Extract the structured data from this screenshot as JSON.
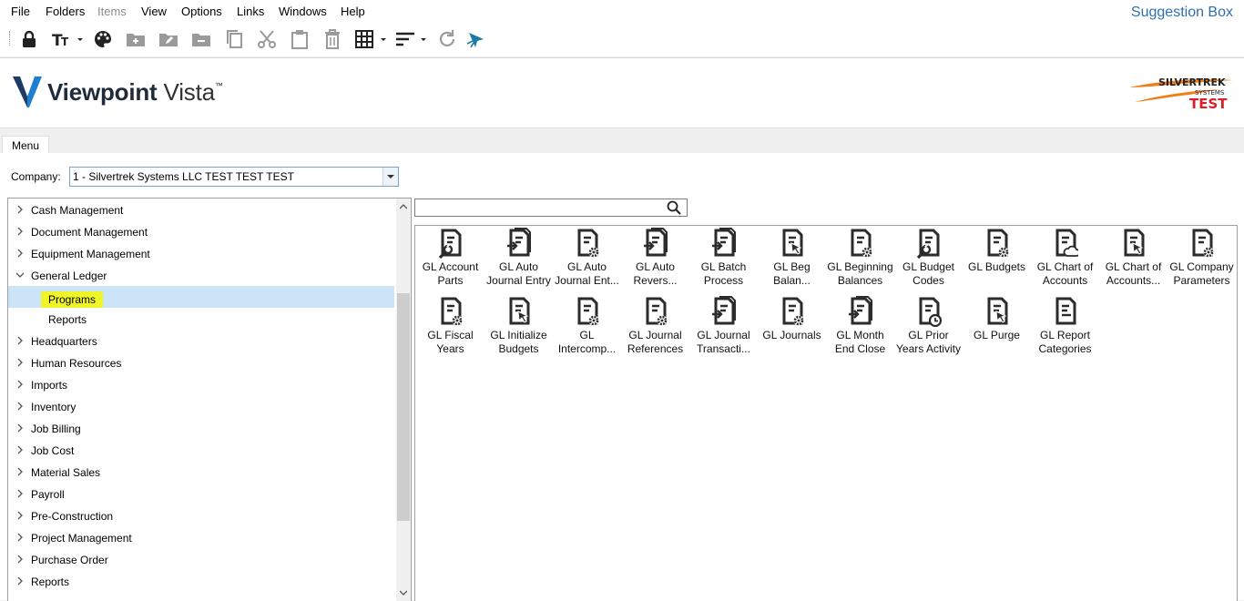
{
  "menu": [
    "File",
    "Folders",
    "Items",
    "View",
    "Options",
    "Links",
    "Windows",
    "Help"
  ],
  "menu_disabled": [
    "Items"
  ],
  "suggestion_box": "Suggestion Box",
  "toolbar_icons": [
    "lock-icon",
    "font-icon",
    "palette-icon",
    "add-folder-icon",
    "edit-folder-icon",
    "remove-folder-icon",
    "copy-icon",
    "cut-icon",
    "paste-icon",
    "delete-icon",
    "grid-icon",
    "sort-icon",
    "refresh-icon",
    "pointer-icon"
  ],
  "brand": {
    "name_bold": "Viewpoint",
    "name_light": "Vista",
    "tm": "™"
  },
  "company_logo": {
    "line1": "SILVERTREK",
    "line2": "SYSTEMS",
    "line3": "TEST"
  },
  "tab": "Menu",
  "company": {
    "label": "Company:",
    "value": "1 - Silvertrek Systems LLC TEST TEST TEST"
  },
  "tree": [
    {
      "label": "Cash Management",
      "level": 0,
      "expanded": false
    },
    {
      "label": "Document Management",
      "level": 0,
      "expanded": false
    },
    {
      "label": "Equipment Management",
      "level": 0,
      "expanded": false
    },
    {
      "label": "General Ledger",
      "level": 0,
      "expanded": true
    },
    {
      "label": "Programs",
      "level": 1,
      "selected": true
    },
    {
      "label": "Reports",
      "level": 1
    },
    {
      "label": "Headquarters",
      "level": 0,
      "expanded": false
    },
    {
      "label": "Human Resources",
      "level": 0,
      "expanded": false
    },
    {
      "label": "Imports",
      "level": 0,
      "expanded": false
    },
    {
      "label": "Inventory",
      "level": 0,
      "expanded": false
    },
    {
      "label": "Job Billing",
      "level": 0,
      "expanded": false
    },
    {
      "label": "Job Cost",
      "level": 0,
      "expanded": false
    },
    {
      "label": "Material Sales",
      "level": 0,
      "expanded": false
    },
    {
      "label": "Payroll",
      "level": 0,
      "expanded": false
    },
    {
      "label": "Pre-Construction",
      "level": 0,
      "expanded": false
    },
    {
      "label": "Project Management",
      "level": 0,
      "expanded": false
    },
    {
      "label": "Purchase Order",
      "level": 0,
      "expanded": false
    },
    {
      "label": "Reports",
      "level": 0,
      "expanded": false
    }
  ],
  "search": {
    "placeholder": ""
  },
  "programs": [
    {
      "line1": "GL Account",
      "line2": "Parts",
      "icon": "wrench"
    },
    {
      "line1": "GL Auto",
      "line2": "Journal Entry",
      "icon": "import-stack"
    },
    {
      "line1": "GL Auto",
      "line2": "Journal Ent...",
      "icon": "gear"
    },
    {
      "line1": "GL Auto",
      "line2": "Revers...",
      "icon": "import-stack"
    },
    {
      "line1": "GL Batch",
      "line2": "Process",
      "icon": "import-stack"
    },
    {
      "line1": "GL Beg",
      "line2": "Balan...",
      "icon": "cursor"
    },
    {
      "line1": "GL Beginning",
      "line2": "Balances",
      "icon": "gear"
    },
    {
      "line1": "GL Budget",
      "line2": "Codes",
      "icon": "wrench"
    },
    {
      "line1": "GL Budgets",
      "line2": "",
      "icon": "gear"
    },
    {
      "line1": "GL Chart of",
      "line2": "Accounts",
      "icon": "cloud"
    },
    {
      "line1": "GL Chart of",
      "line2": "Accounts...",
      "icon": "cursor"
    },
    {
      "line1": "GL Company",
      "line2": "Parameters",
      "icon": "gear"
    },
    {
      "line1": "GL Fiscal",
      "line2": "Years",
      "icon": "gear"
    },
    {
      "line1": "GL Initialize",
      "line2": "Budgets",
      "icon": "cursor"
    },
    {
      "line1": "GL",
      "line2": "Intercomp...",
      "icon": "gear"
    },
    {
      "line1": "GL Journal",
      "line2": "References",
      "icon": "gear"
    },
    {
      "line1": "GL Journal",
      "line2": "Transacti...",
      "icon": "import-stack"
    },
    {
      "line1": "GL Journals",
      "line2": "",
      "icon": "gear"
    },
    {
      "line1": "GL Month",
      "line2": "End Close",
      "icon": "import-stack"
    },
    {
      "line1": "GL Prior",
      "line2": "Years Activity",
      "icon": "clock"
    },
    {
      "line1": "GL Purge",
      "line2": "",
      "icon": "cursor"
    },
    {
      "line1": "GL Report",
      "line2": "Categories",
      "icon": "plain"
    }
  ],
  "colors": {
    "accent_blue": "#2e6fae",
    "selection": "#cce4f7",
    "highlight": "#f0f526",
    "logo_orange": "#f07f1a",
    "logo_red": "#d8202a",
    "icon_dark": "#2b2b2b"
  }
}
